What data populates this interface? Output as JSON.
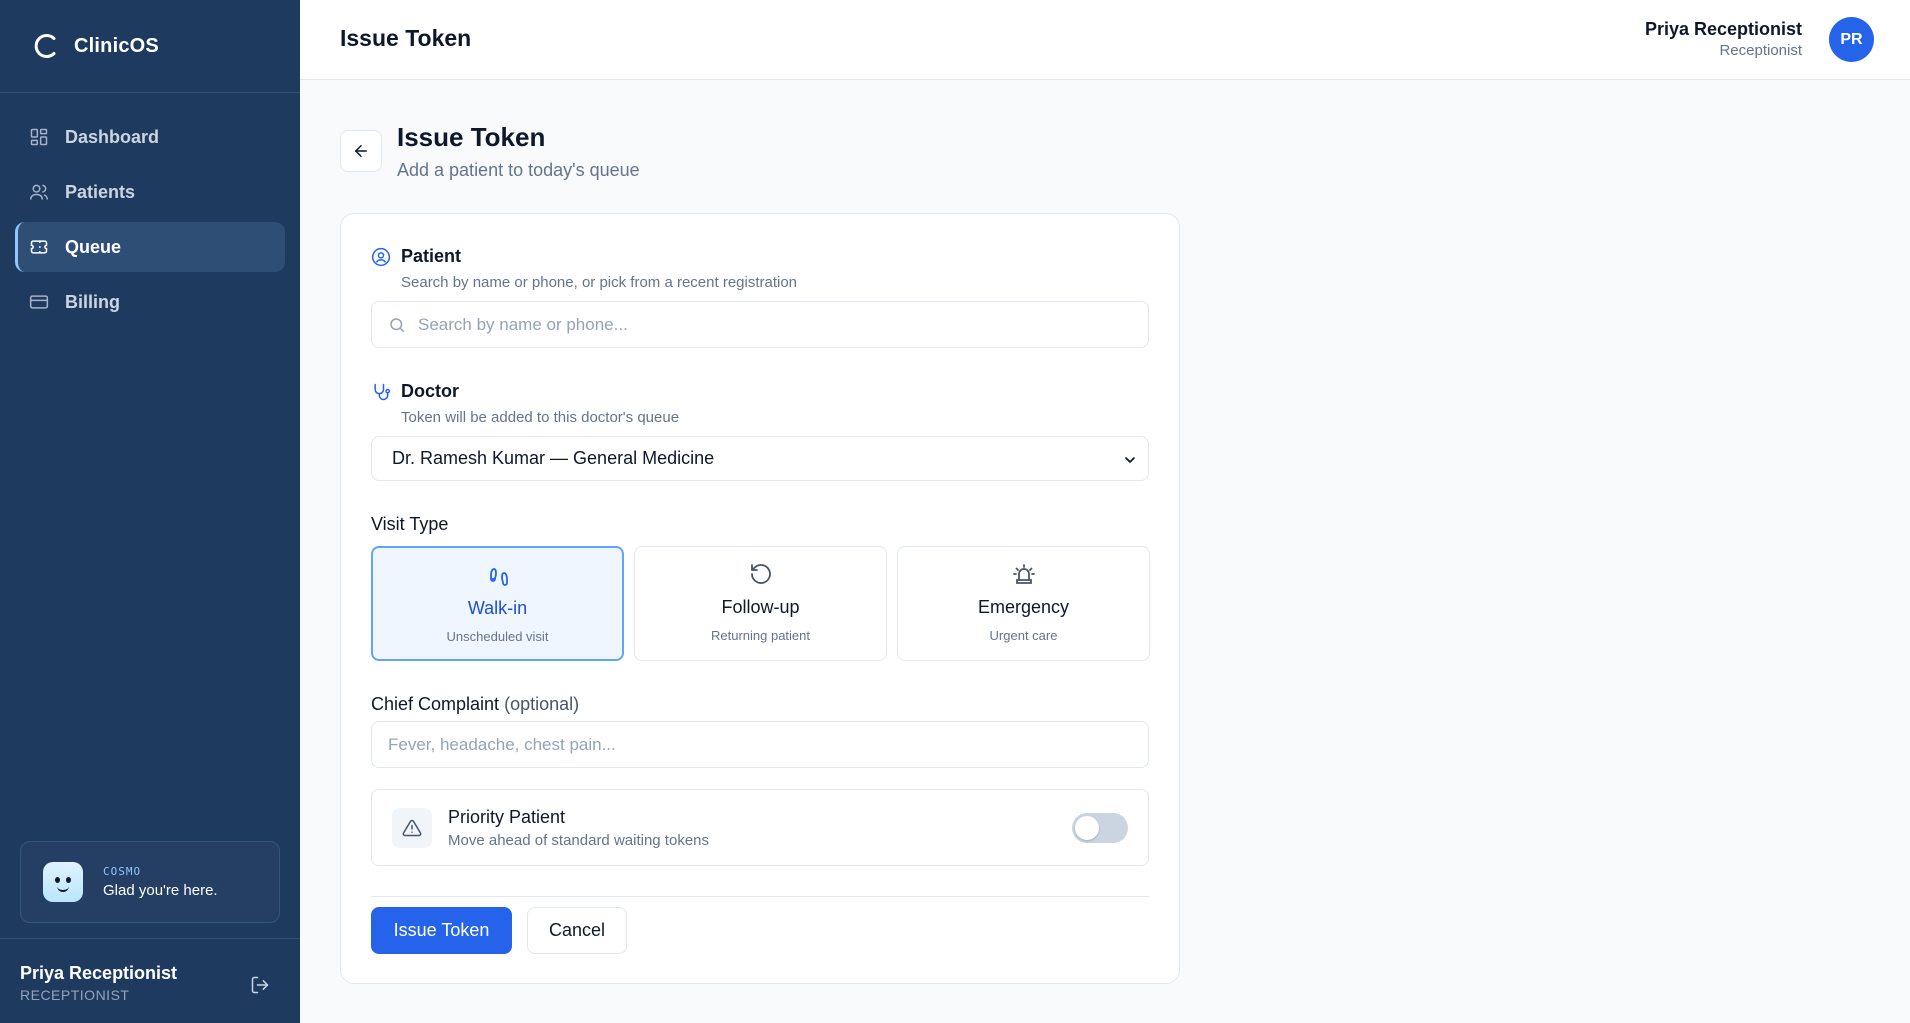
{
  "sidebar": {
    "brand": "ClinicOS",
    "items": [
      {
        "label": "Dashboard",
        "icon": "dashboard-icon"
      },
      {
        "label": "Patients",
        "icon": "users-icon"
      },
      {
        "label": "Queue",
        "icon": "ticket-icon",
        "active": true
      },
      {
        "label": "Billing",
        "icon": "credit-card-icon"
      }
    ],
    "assistant": {
      "label": "COSMO",
      "message": "Glad you're here."
    },
    "user": {
      "name": "Priya Receptionist",
      "role": "RECEPTIONIST"
    }
  },
  "topbar": {
    "title": "Issue Token",
    "user": {
      "name": "Priya Receptionist",
      "role": "Receptionist",
      "initials": "PR"
    }
  },
  "page": {
    "title": "Issue Token",
    "subtitle": "Add a patient to today's queue"
  },
  "form": {
    "patient": {
      "label": "Patient",
      "hint": "Search by name or phone, or pick from a recent registration",
      "placeholder": "Search by name or phone..."
    },
    "doctor": {
      "label": "Doctor",
      "hint": "Token will be added to this doctor's queue",
      "selected": "Dr. Ramesh Kumar — General Medicine"
    },
    "visit_type": {
      "label": "Visit Type",
      "options": [
        {
          "label": "Walk-in",
          "sub": "Unscheduled visit",
          "selected": true
        },
        {
          "label": "Follow-up",
          "sub": "Returning patient",
          "selected": false
        },
        {
          "label": "Emergency",
          "sub": "Urgent care",
          "selected": false
        }
      ]
    },
    "complaint": {
      "label": "Chief Complaint",
      "optional": "(optional)",
      "placeholder": "Fever, headache, chest pain..."
    },
    "priority": {
      "title": "Priority Patient",
      "subtitle": "Move ahead of standard waiting tokens",
      "enabled": false
    },
    "actions": {
      "submit": "Issue Token",
      "cancel": "Cancel"
    }
  },
  "colors": {
    "sidebar_bg": "#1e3a5f",
    "accent": "#2563eb",
    "selected_bg": "#eff6ff"
  }
}
